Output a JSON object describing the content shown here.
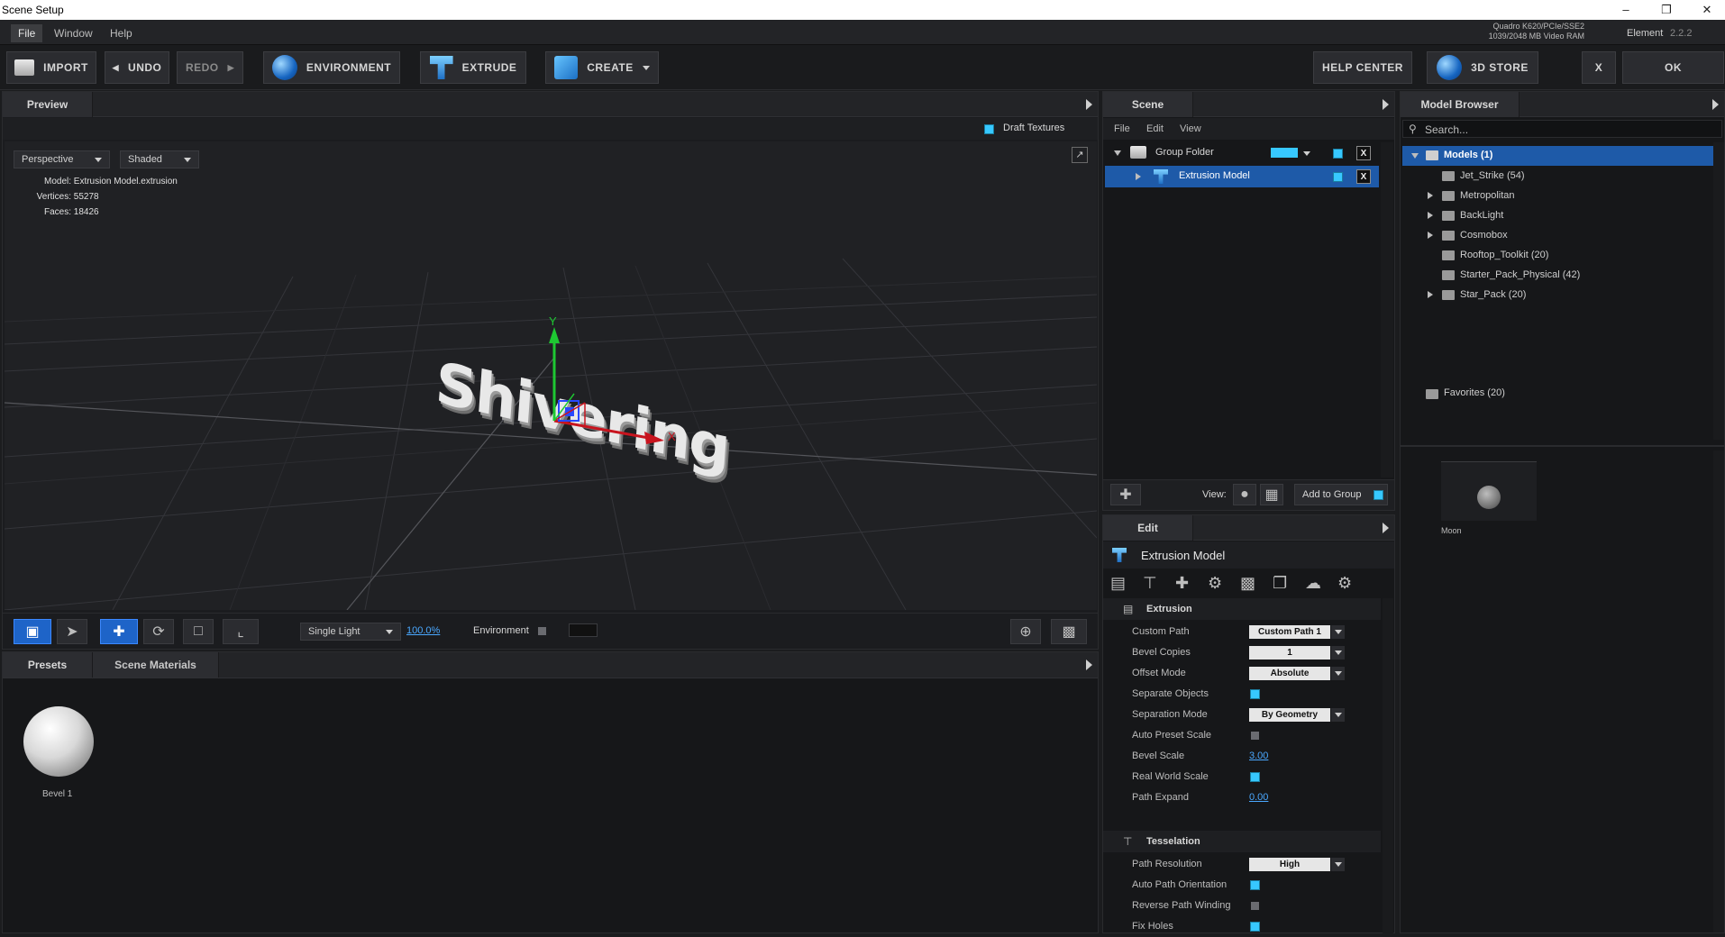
{
  "window": {
    "title": "Scene Setup"
  },
  "menu": [
    "File",
    "Window",
    "Help"
  ],
  "gpu": {
    "line1": "Quadro K620/PCIe/SSE2",
    "line2": "1039/2048 MB Video RAM"
  },
  "product": {
    "name": "Element",
    "version": "2.2.2"
  },
  "toolbar": {
    "import": "IMPORT",
    "undo": "UNDO",
    "redo": "REDO",
    "environment": "ENVIRONMENT",
    "extrude": "EXTRUDE",
    "create": "CREATE",
    "help_center": "HELP CENTER",
    "store": "3D STORE",
    "close": "X",
    "ok": "OK"
  },
  "preview": {
    "tab": "Preview",
    "draft_textures": "Draft Textures",
    "camera_mode": "Perspective",
    "shading": "Shaded",
    "model_label": "Model:",
    "model_value": "Extrusion Model.extrusion",
    "vertices_label": "Vertices:",
    "vertices_value": "55278",
    "faces_label": "Faces:",
    "faces_value": "18426",
    "text_3d": "Shivering",
    "axis_x": "X",
    "axis_y": "Y",
    "light": "Single Light",
    "zoom": "100.0%",
    "environment": "Environment"
  },
  "presets": {
    "tab1": "Presets",
    "tab2": "Scene Materials",
    "material": "Bevel 1"
  },
  "scene": {
    "tab": "Scene",
    "menu": [
      "File",
      "Edit",
      "View"
    ],
    "group": "Group Folder",
    "model": "Extrusion Model",
    "view_label": "View:",
    "add_to_group": "Add to Group"
  },
  "edit": {
    "tab": "Edit",
    "title": "Extrusion Model",
    "section1": "Extrusion",
    "section2": "Tesselation",
    "props1": [
      {
        "label": "Custom Path",
        "type": "dd",
        "value": "Custom Path 1"
      },
      {
        "label": "Bevel Copies",
        "type": "dd",
        "value": "1"
      },
      {
        "label": "Offset Mode",
        "type": "dd",
        "value": "Absolute"
      },
      {
        "label": "Separate Objects",
        "type": "chk",
        "value": true
      },
      {
        "label": "Separation Mode",
        "type": "dd",
        "value": "By Geometry"
      },
      {
        "label": "Auto Preset Scale",
        "type": "chk",
        "value": false
      },
      {
        "label": "Bevel Scale",
        "type": "num",
        "value": "3.00"
      },
      {
        "label": "Real World Scale",
        "type": "chk",
        "value": true
      },
      {
        "label": "Path Expand",
        "type": "num",
        "value": "0.00"
      }
    ],
    "props2": [
      {
        "label": "Path Resolution",
        "type": "dd",
        "value": "High"
      },
      {
        "label": "Auto Path Orientation",
        "type": "chk",
        "value": true
      },
      {
        "label": "Reverse Path Winding",
        "type": "chk",
        "value": false
      },
      {
        "label": "Fix Holes",
        "type": "chk",
        "value": true
      }
    ]
  },
  "browser": {
    "tab": "Model Browser",
    "search_placeholder": "Search...",
    "root": "Models (1)",
    "folders": [
      {
        "name": "Jet_Strike (54)",
        "expandable": false
      },
      {
        "name": "Metropolitan",
        "expandable": true
      },
      {
        "name": "BackLight",
        "expandable": true
      },
      {
        "name": "Cosmobox",
        "expandable": true
      },
      {
        "name": "Rooftop_Toolkit (20)",
        "expandable": false
      },
      {
        "name": "Starter_Pack_Physical (42)",
        "expandable": false
      },
      {
        "name": "Star_Pack (20)",
        "expandable": true
      }
    ],
    "favorites": "Favorites (20)",
    "thumb": "Moon"
  },
  "colors": {
    "accent": "#37c8ff",
    "selection": "#1e5aa8",
    "axis_x": "#c8141e",
    "axis_y": "#1ec832"
  }
}
